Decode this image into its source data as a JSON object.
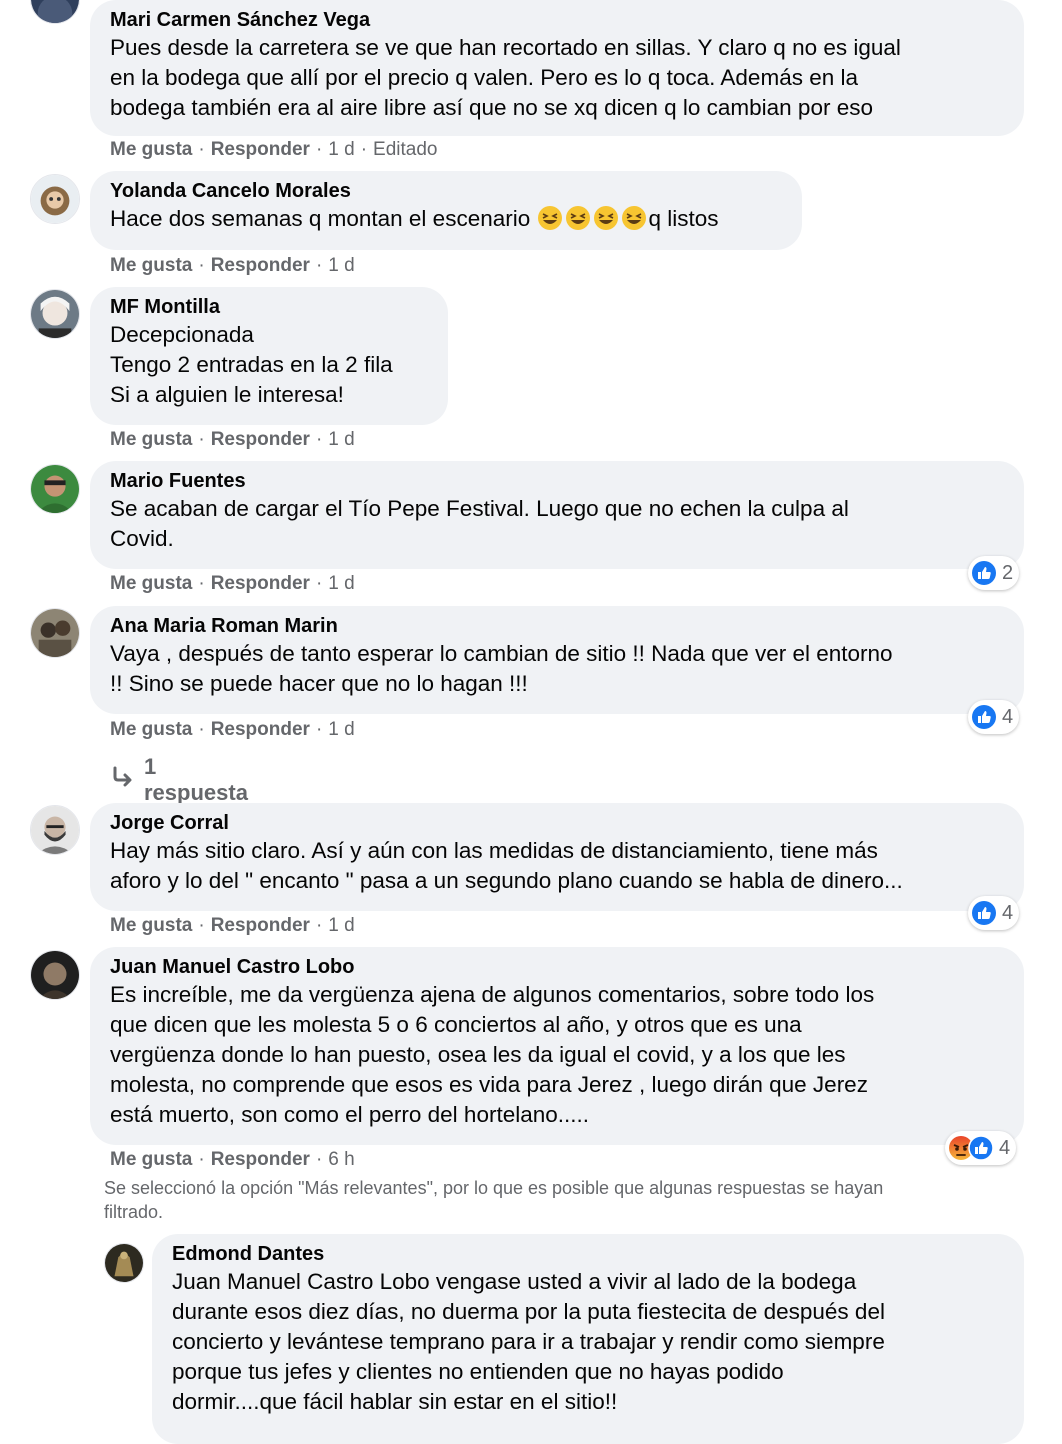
{
  "actions": {
    "like": "Me gusta",
    "reply": "Responder",
    "separator": "·"
  },
  "comments": [
    {
      "author": "Mari Carmen Sánchez Vega",
      "text": "Pues desde la carretera se ve que han recortado en sillas. Y claro q no es igual\nen la bodega que allí por el precio q valen. Pero es lo q toca. Además en la\nbodega también era al aire libre así que no se xq dicen q lo cambian por eso",
      "time": "1 d",
      "edited": "Editado"
    },
    {
      "author": "Yolanda Cancelo Morales",
      "text_before": "Hace dos semanas q montan el escenario ",
      "emoji": "grinning-squinting-face",
      "text_after": "q listos",
      "time": "1 d"
    },
    {
      "author": "MF Montilla",
      "text": "Decepcionada\nTengo 2 entradas en la 2 fila\nSi a alguien le interesa!",
      "time": "1 d"
    },
    {
      "author": "Mario Fuentes",
      "text": "Se acaban de cargar el Tío Pepe Festival. Luego que no echen la culpa al\nCovid.",
      "time": "1 d",
      "reactions": {
        "icons": [
          "like-icon"
        ],
        "count": "2"
      }
    },
    {
      "author": "Ana Maria Roman Marin",
      "text": "Vaya , después de tanto esperar lo cambian de sitio !! Nada que ver el entorno\n!! Sino se puede hacer que no lo hagan !!!",
      "time": "1 d",
      "reactions": {
        "icons": [
          "like-icon"
        ],
        "count": "4"
      },
      "replies_label": "1 respuesta"
    },
    {
      "author": "Jorge Corral",
      "text": "Hay más sitio claro. Así y aún con las medidas de distanciamiento, tiene más\naforo y lo del \" encanto \" pasa a un segundo plano cuando se habla de dinero...",
      "time": "1 d",
      "reactions": {
        "icons": [
          "like-icon"
        ],
        "count": "4"
      }
    },
    {
      "author": "Juan Manuel Castro Lobo",
      "text": "Es increíble, me da vergüenza ajena de algunos comentarios, sobre todo los\nque dicen que les molesta 5 o 6 conciertos al año, y otros que es una\nvergüenza donde lo han puesto, osea les da igual el covid, y a los que les\nmolesta, no comprende que esos es vida para Jerez , luego dirán que Jerez\nestá muerto, son como el perro del hortelano.....",
      "time": "6 h",
      "reactions": {
        "icons": [
          "angry-icon",
          "like-icon"
        ],
        "count": "4"
      }
    }
  ],
  "filter_note": "Se seleccionó la opción \"Más relevantes\", por lo que es posible que algunas respuestas se hayan\nfiltrado.",
  "reply": {
    "author": "Edmond Dantes",
    "text": "Juan Manuel Castro Lobo vengase usted a vivir al lado de la bodega\ndurante esos diez días, no duerma por la puta fiestecita de después del\nconcierto y levántese temprano para ir a trabajar y rendir como siempre\nporque tus jefes y clientes no entienden que no hayas podido\ndormir....que fácil hablar sin estar en el sitio!!"
  },
  "colors": {
    "bubble": "#f0f2f5",
    "meta_text": "#65676b",
    "like_blue": "#1877f2",
    "angry_orange": "#e9710f"
  }
}
